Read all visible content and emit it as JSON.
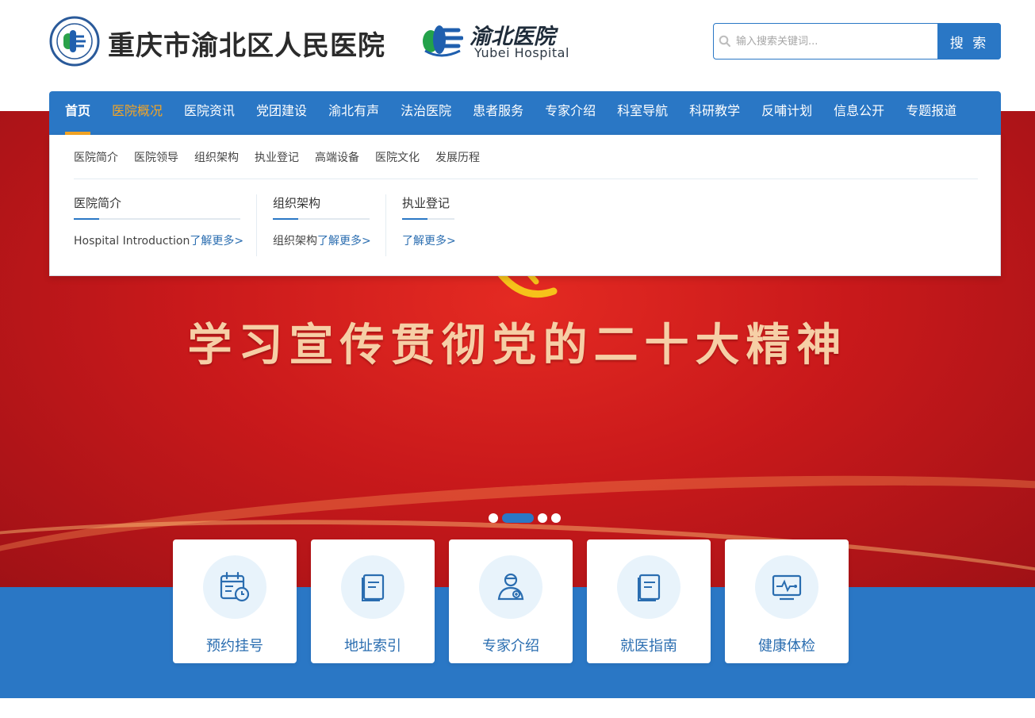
{
  "header": {
    "hospital_name": "重庆市渝北区人民医院",
    "logo_cn": "渝北医院",
    "logo_en": "Yubei Hospital"
  },
  "search": {
    "placeholder": "输入搜索关键词...",
    "button_label": "搜 索"
  },
  "nav": {
    "items": [
      {
        "label": "首页"
      },
      {
        "label": "医院概况"
      },
      {
        "label": "医院资讯"
      },
      {
        "label": "党团建设"
      },
      {
        "label": "渝北有声"
      },
      {
        "label": "法治医院"
      },
      {
        "label": "患者服务"
      },
      {
        "label": "专家介绍"
      },
      {
        "label": "科室导航"
      },
      {
        "label": "科研教学"
      },
      {
        "label": "反哺计划"
      },
      {
        "label": "信息公开"
      },
      {
        "label": "专题报道"
      }
    ]
  },
  "dropdown": {
    "sub_links": [
      "医院简介",
      "医院领导",
      "组织架构",
      "执业登记",
      "高端设备",
      "医院文化",
      "发展历程"
    ],
    "columns": [
      {
        "title": "医院简介",
        "desc": "Hospital Introduction",
        "more": "了解更多>"
      },
      {
        "title": "组织架构",
        "desc": "组织架构",
        "more": "了解更多>"
      },
      {
        "title": "执业登记",
        "desc": "",
        "more": "了解更多>"
      }
    ]
  },
  "banner": {
    "title": "学习宣传贯彻党的二十大精神",
    "slide_count": 4,
    "active_slide": 2
  },
  "quick_links": [
    {
      "label": "预约挂号",
      "icon": "calendar-clock-icon"
    },
    {
      "label": "地址索引",
      "icon": "document-icon"
    },
    {
      "label": "专家介绍",
      "icon": "doctor-icon"
    },
    {
      "label": "就医指南",
      "icon": "guide-book-icon"
    },
    {
      "label": "健康体检",
      "icon": "monitor-pulse-icon"
    }
  ],
  "colors": {
    "primary": "#2a77c5",
    "accent": "#f5a524",
    "banner_red": "#c9191b",
    "text_gold": "#f6cfa6"
  }
}
